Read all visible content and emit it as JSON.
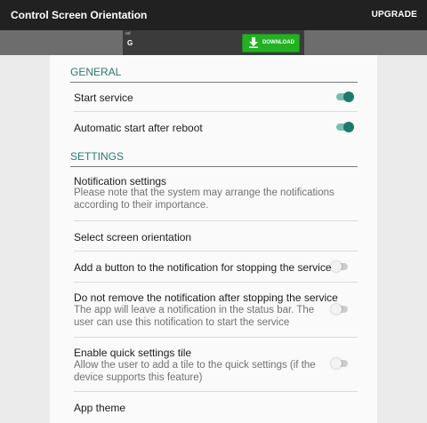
{
  "appbar": {
    "title": "Control Screen Orientation",
    "action": "UPGRADE"
  },
  "ad": {
    "tag": "ad",
    "letter": "G",
    "button": "DOWNLOAD",
    "download_icon": "download-arrow-icon",
    "button_color": "#23b023"
  },
  "sections": {
    "general": "GENERAL",
    "settings": "SETTINGS"
  },
  "general_items": [
    {
      "title": "Start service",
      "switch_on": true
    },
    {
      "title": "Automatic start after reboot",
      "switch_on": true
    }
  ],
  "settings_items": [
    {
      "title": "Notification settings",
      "summary_1": "Please note that the system may arrange the notifications",
      "summary_2": "according to their importance."
    },
    {
      "title": "Select screen orientation"
    },
    {
      "title": "Add a button to the notification for stopping the service",
      "switch_on": false
    },
    {
      "title": "Do not remove the notification after stopping the service",
      "summary_1": "The app will leave a notification in the status bar. The",
      "summary_2": "user can use this notification to start the service",
      "switch_on": false
    },
    {
      "title": "Enable quick settings tile",
      "summary_1": "Allow the user to add a tile to the quick settings (if the",
      "summary_2": "device supports this feature)",
      "switch_on": false
    },
    {
      "title": "App theme"
    }
  ],
  "colors": {
    "accent": "#1e7b6c",
    "section_header": "#2b7a6f",
    "appbar": "#212121"
  }
}
